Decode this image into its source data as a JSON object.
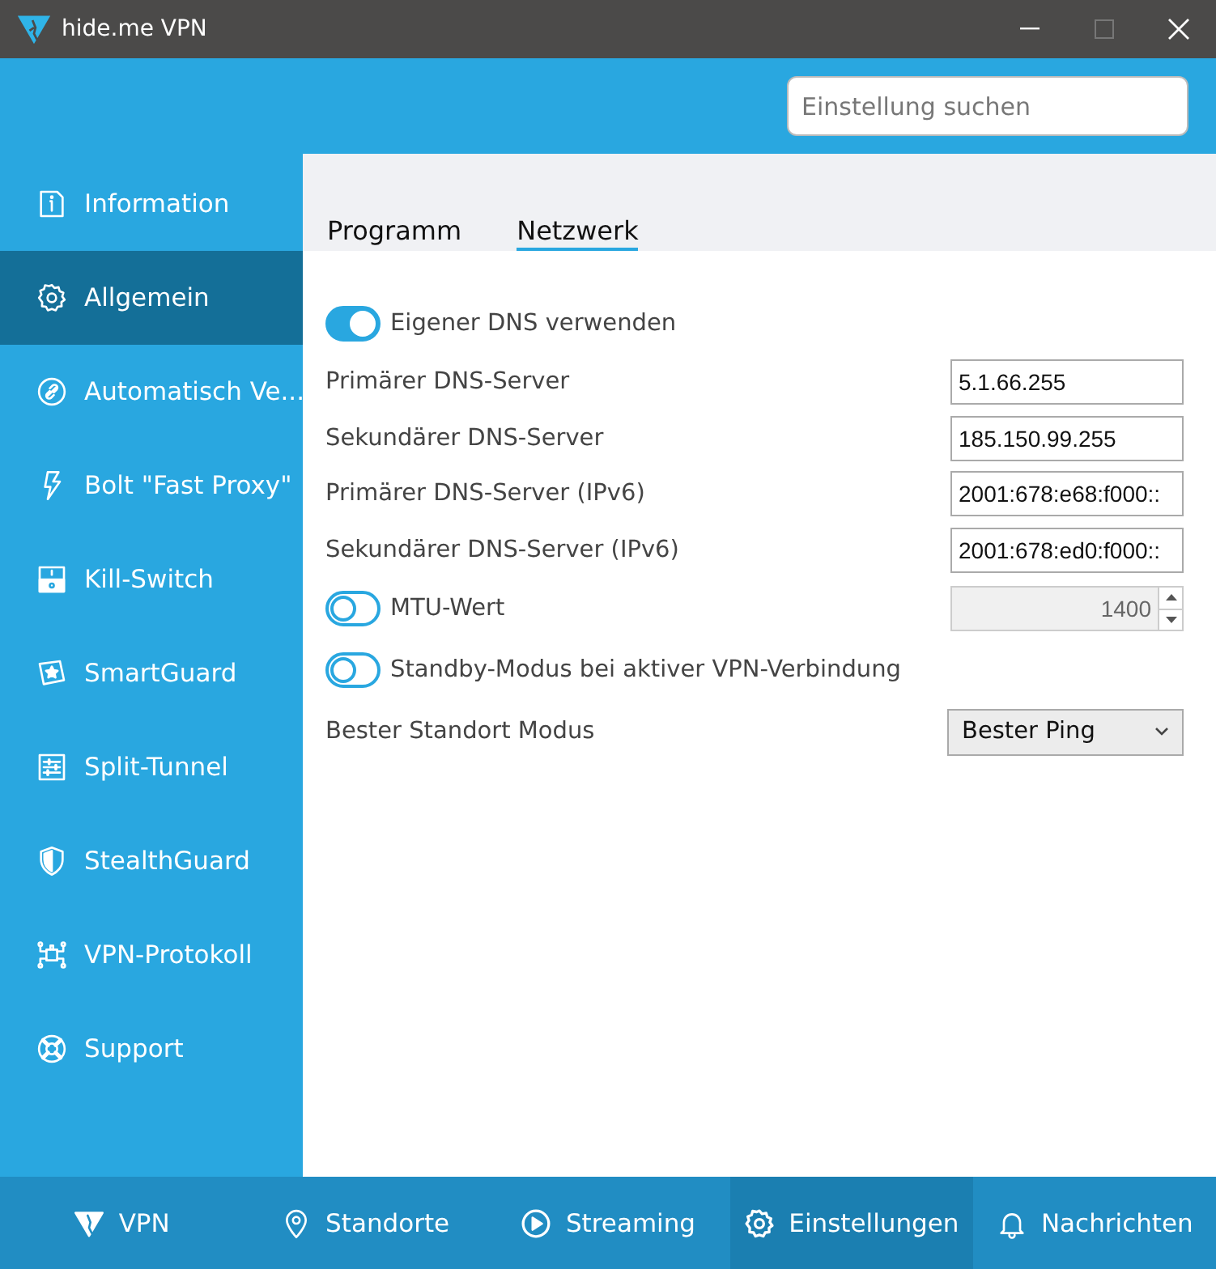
{
  "window": {
    "title": "hide.me VPN"
  },
  "search": {
    "placeholder": "Einstellung suchen"
  },
  "sidebar": {
    "items": [
      {
        "label": "Information",
        "selected": false
      },
      {
        "label": "Allgemein",
        "selected": true
      },
      {
        "label": "Automatisch Ve...",
        "selected": false
      },
      {
        "label": "Bolt \"Fast Proxy\"",
        "selected": false
      },
      {
        "label": "Kill-Switch",
        "selected": false
      },
      {
        "label": "SmartGuard",
        "selected": false
      },
      {
        "label": "Split-Tunnel",
        "selected": false
      },
      {
        "label": "StealthGuard",
        "selected": false
      },
      {
        "label": "VPN-Protokoll",
        "selected": false
      },
      {
        "label": "Support",
        "selected": false
      }
    ]
  },
  "tabs": [
    {
      "label": "Programm",
      "selected": false
    },
    {
      "label": "Netzwerk",
      "selected": true
    }
  ],
  "settings": [
    {
      "kind": "toggle",
      "label": "Eigener DNS verwenden",
      "on": true
    },
    {
      "kind": "text",
      "label": "Primärer DNS-Server",
      "value": "5.1.66.255"
    },
    {
      "kind": "text",
      "label": "Sekundärer DNS-Server",
      "value": "185.150.99.255"
    },
    {
      "kind": "text",
      "label": "Primärer DNS-Server (IPv6)",
      "value": "2001:678:e68:f000::"
    },
    {
      "kind": "text",
      "label": "Sekundärer DNS-Server (IPv6)",
      "value": "2001:678:ed0:f000::"
    },
    {
      "kind": "toggle-spin",
      "label": "MTU-Wert",
      "on": false,
      "value": "1400",
      "disabled": true
    },
    {
      "kind": "toggle",
      "label": "Standby-Modus bei aktiver VPN-Verbindung",
      "on": false
    },
    {
      "kind": "select",
      "label": "Bester Standort Modus",
      "value": "Bester Ping"
    }
  ],
  "bottom_nav": [
    {
      "label": "VPN",
      "selected": false
    },
    {
      "label": "Standorte",
      "selected": false
    },
    {
      "label": "Streaming",
      "selected": false
    },
    {
      "label": "Einstellungen",
      "selected": true
    },
    {
      "label": "Nachrichten",
      "selected": false
    }
  ]
}
